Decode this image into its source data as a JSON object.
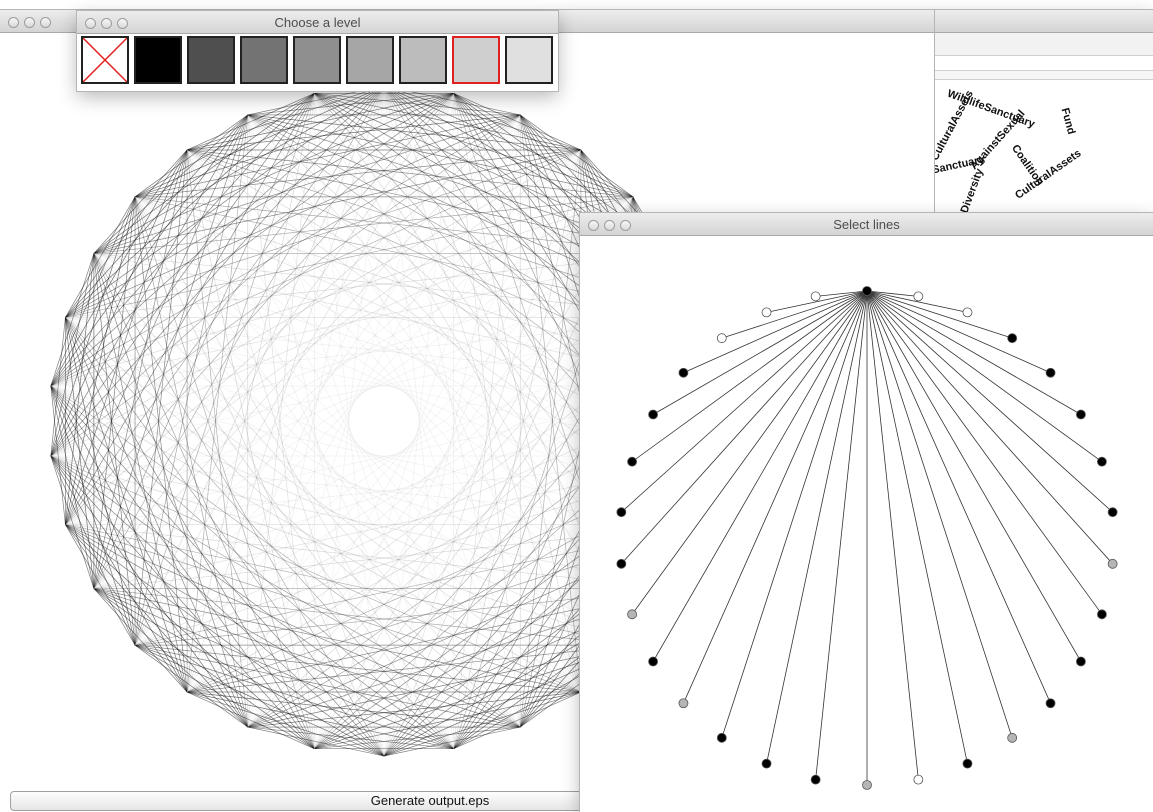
{
  "main_window": {
    "title": ""
  },
  "choose_level": {
    "title": "Choose a level",
    "swatches": [
      {
        "color": "none",
        "crossed": true
      },
      {
        "color": "#000000"
      },
      {
        "color": "#4f4f4f"
      },
      {
        "color": "#737373"
      },
      {
        "color": "#8f8f8f"
      },
      {
        "color": "#a6a6a6"
      },
      {
        "color": "#bcbcbc"
      },
      {
        "color": "#cfcfcf",
        "selected": true
      },
      {
        "color": "#e0e0e0"
      }
    ]
  },
  "select_lines": {
    "title": "Select lines",
    "points": 30,
    "point_levels": [
      "k",
      "w",
      "w",
      "k",
      "k",
      "k",
      "k",
      "k",
      "g",
      "k",
      "k",
      "k",
      "g",
      "k",
      "w",
      "g",
      "k",
      "k",
      "k",
      "g",
      "k",
      "g",
      "k",
      "k",
      "k",
      "k",
      "k",
      "w",
      "w",
      "w"
    ]
  },
  "word_cloud": {
    "phrases": [
      "CulturalAssets",
      "WildlifeSanctuary",
      "AgainstSexual",
      "Coalition",
      "Diversity",
      "Fund"
    ]
  },
  "generate_button": {
    "label": "Generate output.eps"
  },
  "colors": {
    "selection": "#e0201e",
    "title_text": "#4d4d4d"
  }
}
